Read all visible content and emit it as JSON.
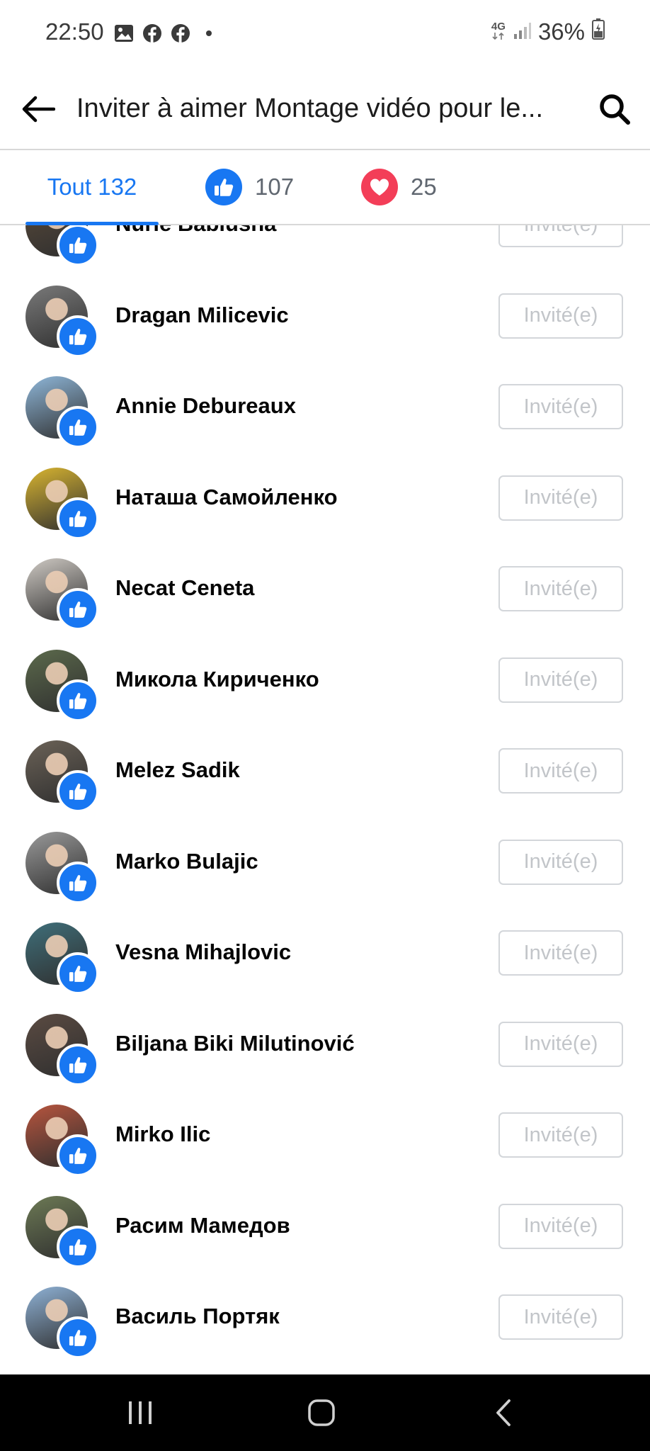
{
  "status_bar": {
    "time": "22:50",
    "icons": [
      "image-icon",
      "facebook-icon",
      "facebook-icon",
      "dot-icon"
    ],
    "network": "4G",
    "battery": "36%"
  },
  "header": {
    "title": "Inviter à aimer Montage vidéo pour le..."
  },
  "tabs": [
    {
      "label": "Tout 132",
      "active": true
    },
    {
      "icon": "like-icon",
      "count": "107",
      "color": "#1877f2"
    },
    {
      "icon": "love-icon",
      "count": "25",
      "color": "#f33e58"
    }
  ],
  "people": [
    {
      "name": "Nurie Bablusha",
      "button": "Invité(e)",
      "avatar_color": "#5a4a3a"
    },
    {
      "name": "Dragan Milicevic",
      "button": "Invité(e)",
      "avatar_color": "#7a7a7a"
    },
    {
      "name": "Annie Debureaux",
      "button": "Invité(e)",
      "avatar_color": "#8fb7d9"
    },
    {
      "name": "Наташа Самойленко",
      "button": "Invité(e)",
      "avatar_color": "#d9b530"
    },
    {
      "name": "Necat Ceneta",
      "button": "Invité(e)",
      "avatar_color": "#cfcac4"
    },
    {
      "name": "Микола Кириченко",
      "button": "Invité(e)",
      "avatar_color": "#5c6a4c"
    },
    {
      "name": "Melez Sadik",
      "button": "Invité(e)",
      "avatar_color": "#6b6257"
    },
    {
      "name": "Marko Bulajic",
      "button": "Invité(e)",
      "avatar_color": "#9a9a9a"
    },
    {
      "name": "Vesna Mihajlovic",
      "button": "Invité(e)",
      "avatar_color": "#3f6f7a"
    },
    {
      "name": "Biljana Biki Milutinović",
      "button": "Invité(e)",
      "avatar_color": "#5b4b42"
    },
    {
      "name": "Mirko Ilic",
      "button": "Invité(e)",
      "avatar_color": "#b8553e"
    },
    {
      "name": "Расим Мамедов",
      "button": "Invité(e)",
      "avatar_color": "#6d7a55"
    },
    {
      "name": "Василь Портяк",
      "button": "Invité(e)",
      "avatar_color": "#8fb2d6"
    }
  ],
  "colors": {
    "accent": "#1877f2",
    "love": "#f33e58",
    "button_border": "#d3d6da",
    "button_text": "#c2c5c9"
  }
}
